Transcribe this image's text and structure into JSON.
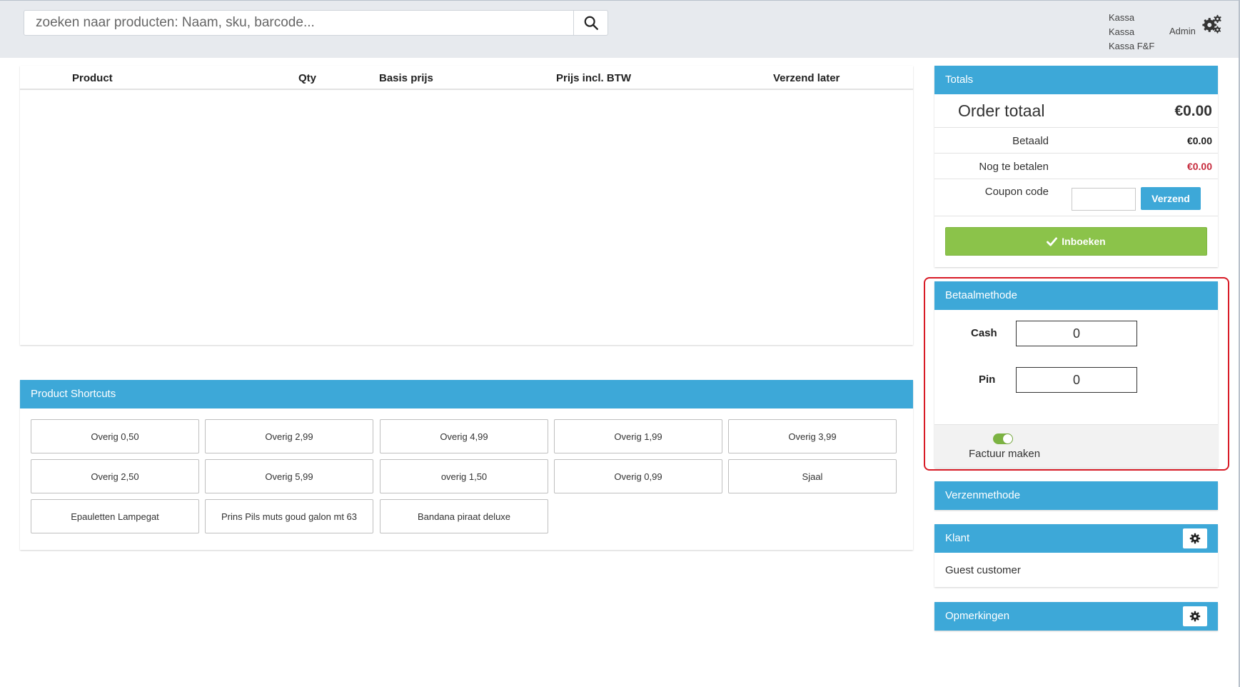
{
  "header": {
    "search": {
      "placeholder": "zoeken naar producten: Naam, sku, barcode...",
      "value": ""
    },
    "store_lines": [
      "Kassa",
      "Kassa",
      "Kassa F&F"
    ],
    "user": "Admin"
  },
  "cart": {
    "columns": [
      "Product",
      "Qty",
      "Basis prijs",
      "Prijs incl. BTW",
      "Verzend later"
    ],
    "rows": []
  },
  "shortcuts": {
    "title": "Product Shortcuts",
    "items": [
      "Overig 0,50",
      "Overig 2,99",
      "Overig 4,99",
      "Overig 1,99",
      "Overig 3,99",
      "Overig 2,50",
      "Overig 5,99",
      "overig 1,50",
      "Overig 0,99",
      "Sjaal",
      "Epauletten Lampegat",
      "Prins Pils muts goud galon mt 63",
      "Bandana piraat deluxe"
    ]
  },
  "totals": {
    "title": "Totals",
    "order_total_label": "Order totaal",
    "order_total_value": "€0.00",
    "paid_label": "Betaald",
    "paid_value": "€0.00",
    "remaining_label": "Nog te betalen",
    "remaining_value": "€0.00",
    "coupon_label": "Coupon code",
    "coupon_value": "",
    "coupon_button": "Verzend",
    "book_button": "Inboeken"
  },
  "payment": {
    "title": "Betaalmethode",
    "cash_label": "Cash",
    "cash_value": "0",
    "pin_label": "Pin",
    "pin_value": "0",
    "invoice_label": "Factuur maken",
    "invoice_enabled": true
  },
  "shipping": {
    "title": "Verzenmethode"
  },
  "customer": {
    "title": "Klant",
    "name": "Guest customer"
  },
  "notes": {
    "title": "Opmerkingen"
  },
  "colors": {
    "accent": "#3da8d8",
    "success": "#8bc34a",
    "danger": "#c62a3c",
    "highlight_border": "#d81b26"
  },
  "icons": {
    "search": "search-icon",
    "settings": "gears-icon",
    "check": "check-icon",
    "gear": "gear-icon"
  }
}
